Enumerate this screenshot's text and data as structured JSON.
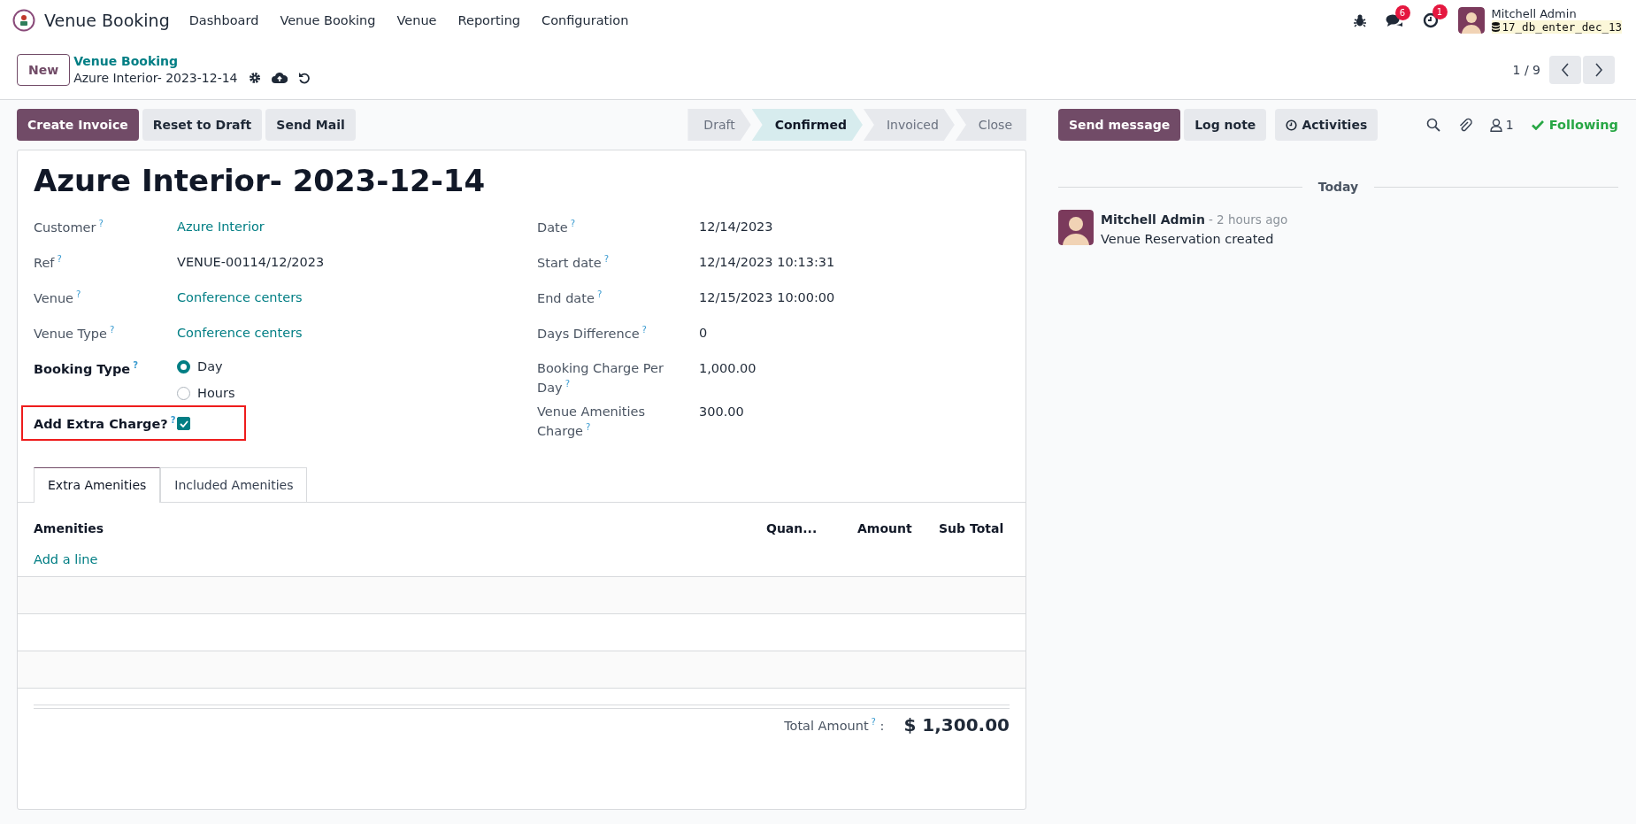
{
  "navbar": {
    "app_name": "Venue Booking",
    "menu": [
      "Dashboard",
      "Venue Booking",
      "Venue",
      "Reporting",
      "Configuration"
    ],
    "messages_count": "6",
    "activities_count": "1",
    "user": {
      "name": "Mitchell Admin",
      "database": "17_db_enter_dec_13"
    }
  },
  "control_panel": {
    "new_button": "New",
    "breadcrumb": "Venue Booking",
    "record_name": "Azure Interior- 2023-12-14",
    "pager": "1 / 9"
  },
  "actions": [
    {
      "label": "Create Invoice",
      "kind": "primary"
    },
    {
      "label": "Reset to Draft",
      "kind": "secondary"
    },
    {
      "label": "Send Mail",
      "kind": "secondary"
    }
  ],
  "statusbar": [
    {
      "label": "Draft",
      "selected": false
    },
    {
      "label": "Confirmed",
      "selected": true
    },
    {
      "label": "Invoiced",
      "selected": false
    },
    {
      "label": "Close",
      "selected": false
    }
  ],
  "form": {
    "title": "Azure Interior- 2023-12-14",
    "left_fields": [
      {
        "kind": "link",
        "label": "Customer",
        "help": "?",
        "required": false,
        "value": "Azure Interior"
      },
      {
        "kind": "text",
        "label": "Ref",
        "help": "?",
        "required": false,
        "value": "VENUE-00114/12/2023"
      },
      {
        "kind": "link",
        "label": "Venue",
        "help": "?",
        "required": false,
        "value": "Conference centers"
      },
      {
        "kind": "link",
        "label": "Venue Type",
        "help": "?",
        "required": false,
        "value": "Conference centers"
      },
      {
        "kind": "radio",
        "label": "Booking Type",
        "help": "?",
        "required": true,
        "options": [
          {
            "label": "Day",
            "selected": true
          },
          {
            "label": "Hours",
            "selected": false
          }
        ]
      },
      {
        "kind": "checkbox",
        "label": "Add Extra Charge?",
        "help": "?",
        "required": true,
        "checked": true,
        "highlighted": true
      }
    ],
    "right_fields": [
      {
        "label": "Date",
        "help": "?",
        "value": "12/14/2023"
      },
      {
        "label": "Start date",
        "help": "?",
        "value": "12/14/2023 10:13:31"
      },
      {
        "label": "End date",
        "help": "?",
        "value": "12/15/2023 10:00:00"
      },
      {
        "label": "Days Difference",
        "help": "?",
        "value": "0"
      },
      {
        "label": "Booking Charge Per Day",
        "help": "?",
        "value": "1,000.00"
      },
      {
        "label": "Venue Amenities Charge",
        "help": "?",
        "value": "300.00"
      }
    ],
    "tabs": [
      {
        "label": "Extra Amenities",
        "selected": true
      },
      {
        "label": "Included Amenities",
        "selected": false
      }
    ],
    "table": {
      "columns": [
        "Amenities",
        "Quan...",
        "Amount",
        "Sub Total"
      ],
      "add_line": "Add a line"
    },
    "total": {
      "label": "Total Amount",
      "help": "?",
      "colon": ":",
      "value": "$ 1,300.00"
    }
  },
  "chatter": {
    "buttons": [
      {
        "label": "Send message",
        "kind": "primary"
      },
      {
        "label": "Log note",
        "kind": "secondary"
      },
      {
        "label": "Activities",
        "kind": "activities"
      }
    ],
    "followers": "1",
    "following": "Following",
    "date_separator": "Today",
    "messages": [
      {
        "author": "Mitchell Admin",
        "time": "- 2 hours ago",
        "body": "Venue Reservation created"
      }
    ]
  }
}
